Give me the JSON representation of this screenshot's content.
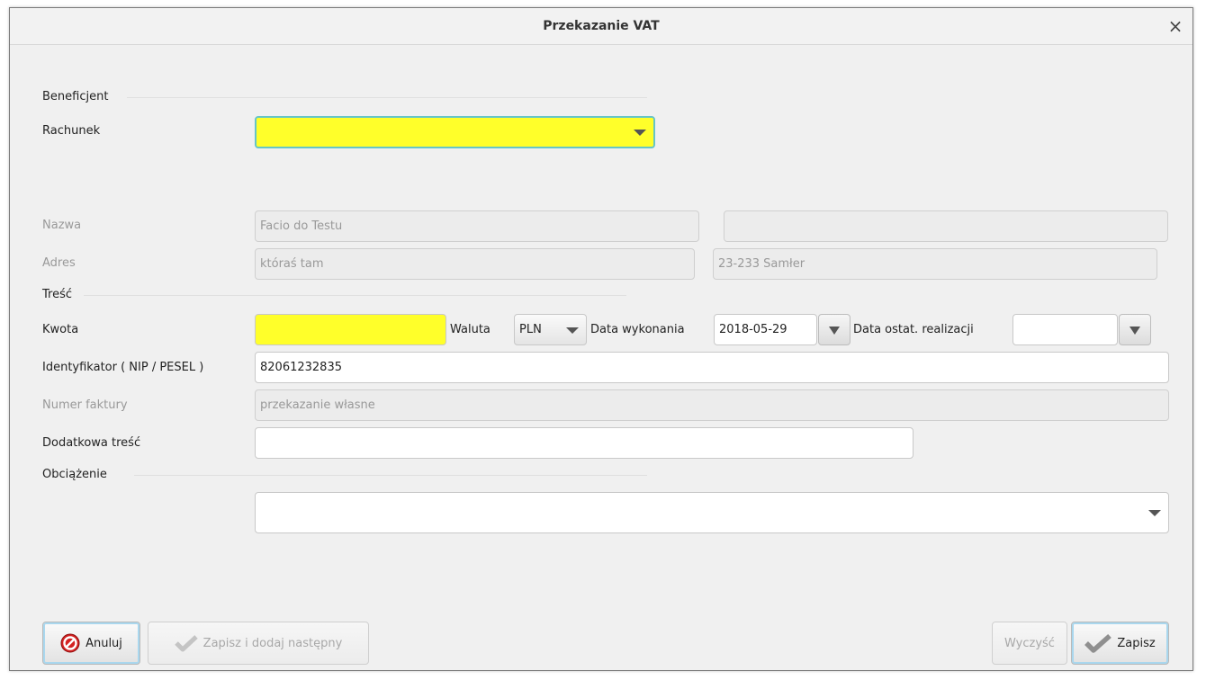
{
  "window": {
    "title": "Przekazanie VAT",
    "close_label": "×"
  },
  "beneficjent": {
    "section_label": "Beneficjent",
    "rachunek_label": "Rachunek",
    "rachunek_value": "",
    "nazwa_label": "Nazwa",
    "nazwa_value1": "Facio do Testu",
    "nazwa_value2": "",
    "adres_label": "Adres",
    "adres_value1": "któraś tam",
    "adres_value2": "23-233 Samłer"
  },
  "tresc": {
    "section_label": "Treść",
    "kwota_label": "Kwota",
    "kwota_value": "",
    "waluta_label": "Waluta",
    "waluta_value": "PLN",
    "data_wykonania_label": "Data wykonania",
    "data_wykonania_value": "2018-05-29",
    "data_ostat_label": "Data ostat. realizacji",
    "data_ostat_value": "",
    "identyfikator_label": "Identyfikator ( NIP / PESEL )",
    "identyfikator_value": "82061232835",
    "numer_faktury_label": "Numer faktury",
    "numer_faktury_value": "przekazanie własne",
    "dodatkowa_label": "Dodatkowa treść",
    "dodatkowa_value": ""
  },
  "obciazenie": {
    "section_label": "Obciążenie",
    "value": ""
  },
  "buttons": {
    "anuluj": "Anuluj",
    "zapisz_dodaj": "Zapisz i dodaj następny",
    "wyczysc": "Wyczyść",
    "zapisz": "Zapisz"
  },
  "colors": {
    "required_field": "#ffff2a",
    "focus_border": "#66c5c7"
  }
}
